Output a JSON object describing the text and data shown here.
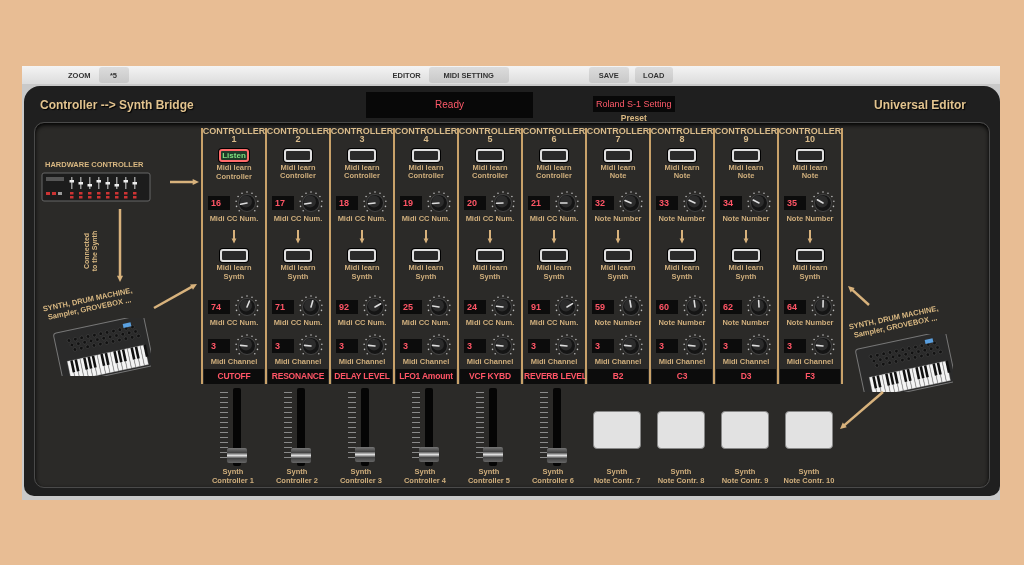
{
  "toolbar": {
    "zoom_label": "ZOOM",
    "zoom_value": "*5",
    "editor_label": "EDITOR",
    "midi_setting_button": "MIDI SETTING",
    "save_button": "SAVE",
    "load_button": "LOAD"
  },
  "header": {
    "title": "Controller --> Synth Bridge",
    "status": "Ready",
    "preset": "Roland S-1 Setting",
    "preset_label": "Preset",
    "app_name": "Universal Editor"
  },
  "left_panel": {
    "hardware_label": "HARDWARE CONTROLLER",
    "connection_label": "Connected\nto the Synth",
    "synth_label": "SYNTH, DRUM MACHINE,\nSampler, GROVEBOX ..."
  },
  "right_panel": {
    "synth_label": "SYNTH, DRUM MACHINE,\nSampler, GROVEBOX ..."
  },
  "strips": [
    {
      "header": "CONTROLLER",
      "number": "1",
      "learn_in": {
        "label": "Listen",
        "listening": true
      },
      "learn_in_label": "Midi learn\nController",
      "in_value": "16",
      "in_label": "Midi CC Num.",
      "learn_out": {
        "listening": false
      },
      "learn_out_label": "Midi learn\nSynth",
      "out_value": "74",
      "out_label": "Midi CC Num.",
      "channel": "3",
      "channel_label": "Midi Channel",
      "name": "CUTOFF",
      "output": {
        "kind": "fader",
        "level": 0.04
      },
      "footer": "Synth\nController 1"
    },
    {
      "header": "CONTROLLER",
      "number": "2",
      "learn_in": {
        "listening": false
      },
      "learn_in_label": "Midi learn\nController",
      "in_value": "17",
      "in_label": "Midi CC Num.",
      "learn_out": {
        "listening": false
      },
      "learn_out_label": "Midi learn\nSynth",
      "out_value": "71",
      "out_label": "Midi CC Num.",
      "channel": "3",
      "channel_label": "Midi Channel",
      "name": "RESONANCE",
      "output": {
        "kind": "fader",
        "level": 0.04
      },
      "footer": "Synth\nController 2"
    },
    {
      "header": "CONTROLLER",
      "number": "3",
      "learn_in": {
        "listening": false
      },
      "learn_in_label": "Midi learn\nController",
      "in_value": "18",
      "in_label": "Midi CC Num.",
      "learn_out": {
        "listening": false
      },
      "learn_out_label": "Midi learn\nSynth",
      "out_value": "92",
      "out_label": "Midi CC Num.",
      "channel": "3",
      "channel_label": "Midi Channel",
      "name": "DELAY LEVEL",
      "output": {
        "kind": "fader",
        "level": 0.05
      },
      "footer": "Synth\nController 3"
    },
    {
      "header": "CONTROLLER",
      "number": "4",
      "learn_in": {
        "listening": false
      },
      "learn_in_label": "Midi learn\nController",
      "in_value": "19",
      "in_label": "Midi CC Num.",
      "learn_out": {
        "listening": false
      },
      "learn_out_label": "Midi learn\nSynth",
      "out_value": "25",
      "out_label": "Midi CC Num.",
      "channel": "3",
      "channel_label": "Midi Channel",
      "name": "LFO1 Amount",
      "output": {
        "kind": "fader",
        "level": 0.06
      },
      "footer": "Synth\nController 4"
    },
    {
      "header": "CONTROLLER",
      "number": "5",
      "learn_in": {
        "listening": false
      },
      "learn_in_label": "Midi learn\nController",
      "in_value": "20",
      "in_label": "Midi CC Num.",
      "learn_out": {
        "listening": false
      },
      "learn_out_label": "Midi learn\nSynth",
      "out_value": "24",
      "out_label": "Midi CC Num.",
      "channel": "3",
      "channel_label": "Midi Channel",
      "name": "VCF KYBD",
      "output": {
        "kind": "fader",
        "level": 0.06
      },
      "footer": "Synth\nController 5"
    },
    {
      "header": "CONTROLLER",
      "number": "6",
      "learn_in": {
        "listening": false
      },
      "learn_in_label": "Midi learn\nController",
      "in_value": "21",
      "in_label": "Midi CC Num.",
      "learn_out": {
        "listening": false
      },
      "learn_out_label": "Midi learn\nSynth",
      "out_value": "91",
      "out_label": "Midi CC Num.",
      "channel": "3",
      "channel_label": "Midi Channel",
      "name": "REVERB LEVEL",
      "output": {
        "kind": "fader",
        "level": 0.04
      },
      "footer": "Synth\nController 6"
    },
    {
      "header": "CONTROLLER",
      "number": "7",
      "learn_in": {
        "listening": false
      },
      "learn_in_label": "Midi learn\nNote",
      "in_value": "32",
      "in_label": "Note Number",
      "learn_out": {
        "listening": false
      },
      "learn_out_label": "Midi learn\nSynth",
      "out_value": "59",
      "out_label": "Note Number",
      "channel": "3",
      "channel_label": "Midi Channel",
      "name": "B2",
      "output": {
        "kind": "pad"
      },
      "footer": "Synth\nNote Contr. 7"
    },
    {
      "header": "CONTROLLER",
      "number": "8",
      "learn_in": {
        "listening": false
      },
      "learn_in_label": "Midi learn\nNote",
      "in_value": "33",
      "in_label": "Note Number",
      "learn_out": {
        "listening": false
      },
      "learn_out_label": "Midi learn\nSynth",
      "out_value": "60",
      "out_label": "Note Number",
      "channel": "3",
      "channel_label": "Midi Channel",
      "name": "C3",
      "output": {
        "kind": "pad"
      },
      "footer": "Synth\nNote Contr. 8"
    },
    {
      "header": "CONTROLLER",
      "number": "9",
      "learn_in": {
        "listening": false
      },
      "learn_in_label": "Midi learn\nNote",
      "in_value": "34",
      "in_label": "Note Number",
      "learn_out": {
        "listening": false
      },
      "learn_out_label": "Midi learn\nSynth",
      "out_value": "62",
      "out_label": "Note Number",
      "channel": "3",
      "channel_label": "Midi Channel",
      "name": "D3",
      "output": {
        "kind": "pad"
      },
      "footer": "Synth\nNote Contr. 9"
    },
    {
      "header": "CONTROLLER",
      "number": "10",
      "learn_in": {
        "listening": false
      },
      "learn_in_label": "Midi learn\nNote",
      "in_value": "35",
      "in_label": "Note Number",
      "learn_out": {
        "listening": false
      },
      "learn_out_label": "Midi learn\nSynth",
      "out_value": "64",
      "out_label": "Note Number",
      "channel": "3",
      "channel_label": "Midi Channel",
      "name": "F3",
      "output": {
        "kind": "pad"
      },
      "footer": "Synth\nNote Contr. 10"
    }
  ]
}
